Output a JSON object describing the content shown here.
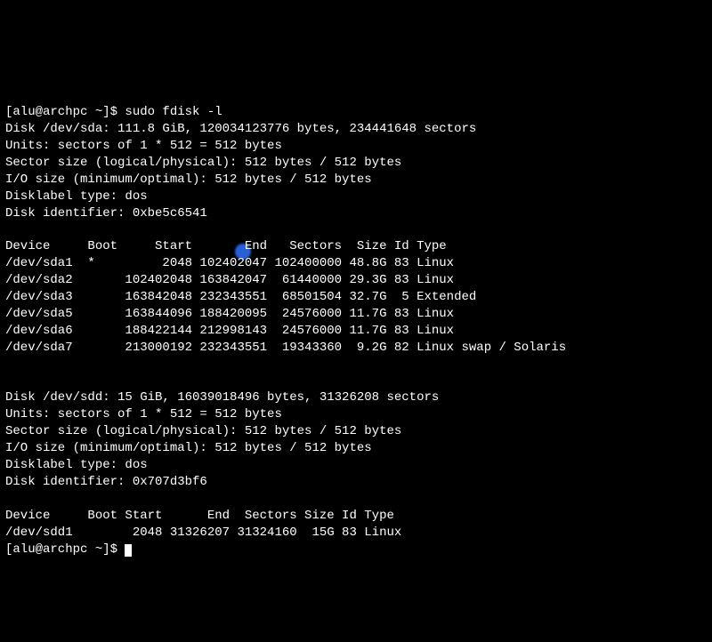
{
  "prompt1": "[alu@archpc ~]$ sudo fdisk -l",
  "sda": {
    "header": "Disk /dev/sda: 111.8 GiB, 120034123776 bytes, 234441648 sectors",
    "units": "Units: sectors of 1 * 512 = 512 bytes",
    "sector": "Sector size (logical/physical): 512 bytes / 512 bytes",
    "io": "I/O size (minimum/optimal): 512 bytes / 512 bytes",
    "label": "Disklabel type: dos",
    "ident": "Disk identifier: 0xbe5c6541",
    "table_header": "Device     Boot     Start       End   Sectors  Size Id Type",
    "rows": [
      "/dev/sda1  *         2048 102402047 102400000 48.8G 83 Linux",
      "/dev/sda2       102402048 163842047  61440000 29.3G 83 Linux",
      "/dev/sda3       163842048 232343551  68501504 32.7G  5 Extended",
      "/dev/sda5       163844096 188420095  24576000 11.7G 83 Linux",
      "/dev/sda6       188422144 212998143  24576000 11.7G 83 Linux",
      "/dev/sda7       213000192 232343551  19343360  9.2G 82 Linux swap / Solaris"
    ]
  },
  "sdd": {
    "header": "Disk /dev/sdd: 15 GiB, 16039018496 bytes, 31326208 sectors",
    "units": "Units: sectors of 1 * 512 = 512 bytes",
    "sector": "Sector size (logical/physical): 512 bytes / 512 bytes",
    "io": "I/O size (minimum/optimal): 512 bytes / 512 bytes",
    "label": "Disklabel type: dos",
    "ident": "Disk identifier: 0x707d3bf6",
    "table_header": "Device     Boot Start      End  Sectors Size Id Type",
    "rows": [
      "/dev/sdd1        2048 31326207 31324160  15G 83 Linux"
    ]
  },
  "prompt2": "[alu@archpc ~]$ "
}
